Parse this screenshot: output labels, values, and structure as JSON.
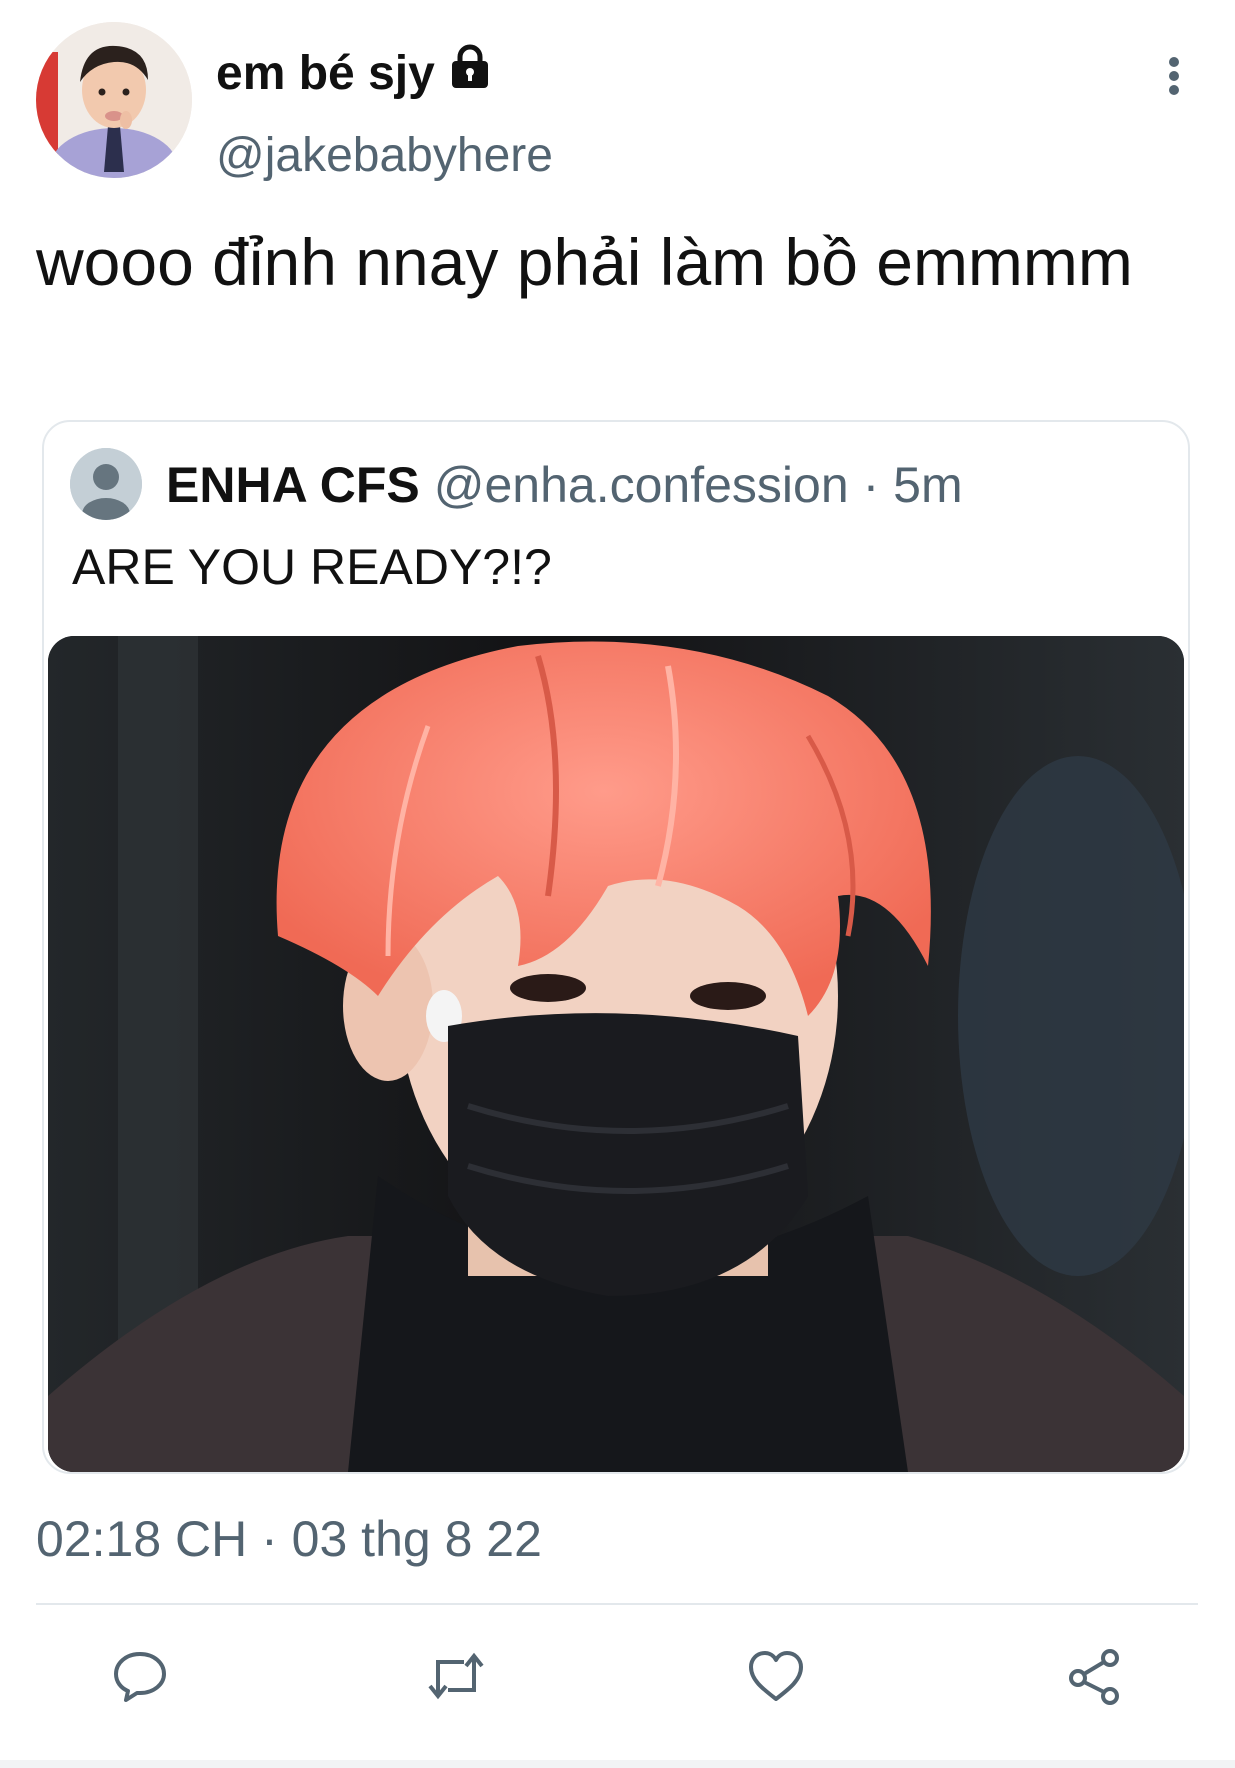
{
  "author": {
    "display_name": "em bé sjy",
    "handle": "@jakebabyhere",
    "protected_icon": "lock-icon"
  },
  "tweet": {
    "text": "wooo đỉnh nnay phải làm bồ emmmm",
    "timestamp": "02:18 CH · 03 thg 8 22"
  },
  "quoted_tweet": {
    "name": "ENHA CFS",
    "handle": "@enha.confession",
    "age": "· 5m",
    "text": "ARE YOU READY?!?",
    "media_icon": "photo"
  },
  "actions": [
    {
      "icon": "reply-icon"
    },
    {
      "icon": "retweet-icon"
    },
    {
      "icon": "like-icon"
    },
    {
      "icon": "share-icon"
    }
  ],
  "colors": {
    "text_primary": "#0f1419",
    "text_secondary": "#536471",
    "border": "#e3e8ec",
    "hair": "#f0897a"
  }
}
